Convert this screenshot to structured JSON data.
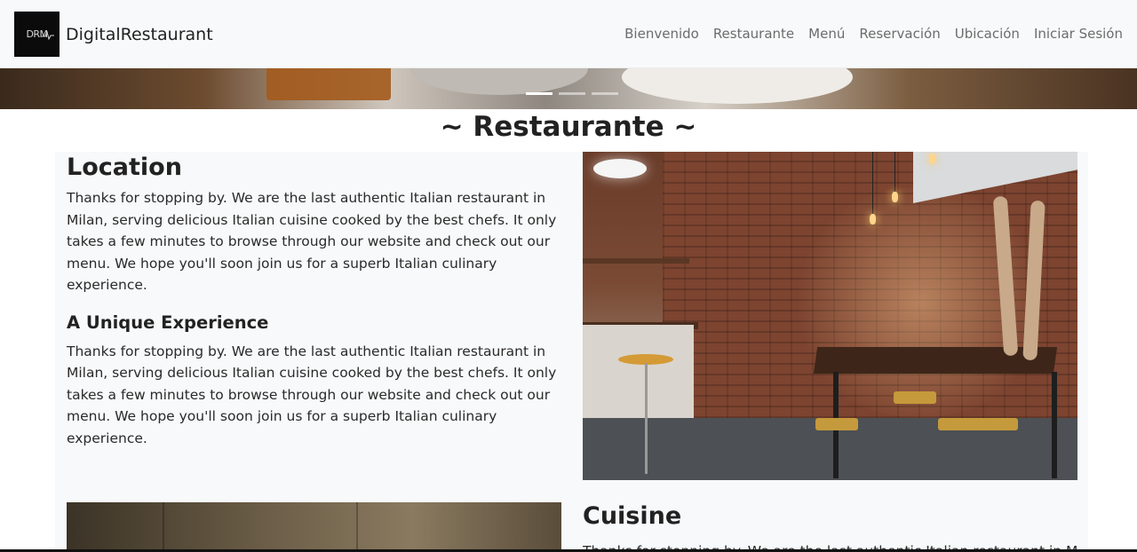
{
  "navbar": {
    "logo_text": "DRM",
    "brand": "DigitalRestaurant",
    "links": [
      "Bienvenido",
      "Restaurante",
      "Menú",
      "Reservación",
      "Ubicación",
      "Iniciar Sesión"
    ]
  },
  "carousel": {
    "slide_count": 3,
    "active_index": 0
  },
  "section": {
    "title": "~ Restaurante ~"
  },
  "content": {
    "location": {
      "heading": "Location",
      "text": "Thanks for stopping by. We are the last authentic Italian restaurant in Milan, serving delicious Italian cuisine cooked by the best chefs. It only takes a few minutes to browse through our website and check out our menu. We hope you'll soon join us for a superb Italian culinary experience."
    },
    "unique": {
      "heading": "A Unique Experience",
      "text": "Thanks for stopping by. We are the last authentic Italian restaurant in Milan, serving delicious Italian cuisine cooked by the best chefs. It only takes a few minutes to browse through our website and check out our menu. We hope you'll soon join us for a superb Italian culinary experience."
    },
    "cuisine": {
      "heading": "Cuisine",
      "text": "Thanks for stopping by. We are the last authentic Italian restaurant in Milan"
    }
  },
  "colors": {
    "navbar_bg": "#f8f9fa",
    "panel_bg": "#f8f9fa",
    "logo_bg": "#0b0b0b",
    "nav_link": "#6c6c6c",
    "heading": "#222222"
  }
}
